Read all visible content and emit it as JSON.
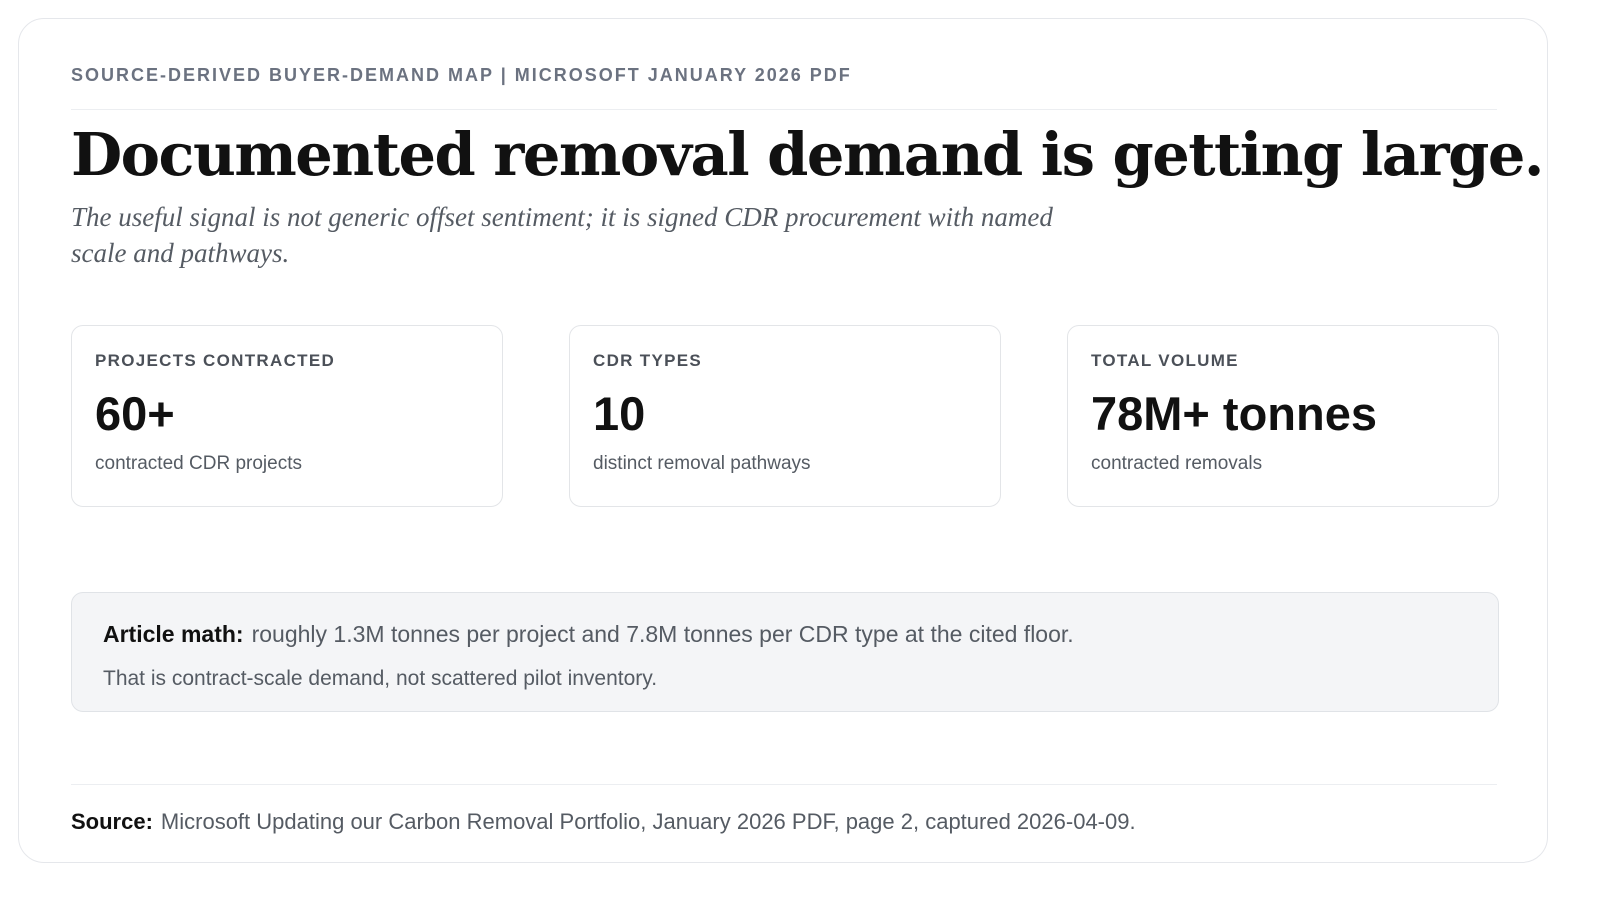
{
  "eyebrow": "SOURCE-DERIVED BUYER-DEMAND MAP | MICROSOFT JANUARY 2026 PDF",
  "headline": "Documented removal demand is getting large.",
  "subhead": "The useful signal is not generic offset sentiment; it is signed CDR procurement with named scale and pathways.",
  "stats": [
    {
      "label": "PROJECTS CONTRACTED",
      "value": "60+",
      "note": "contracted CDR projects"
    },
    {
      "label": "CDR TYPES",
      "value": "10",
      "note": "distinct removal pathways"
    },
    {
      "label": "TOTAL VOLUME",
      "value": "78M+ tonnes",
      "note": "contracted removals"
    }
  ],
  "callout": {
    "key": "Article math:",
    "text": "roughly 1.3M tonnes per project and 7.8M tonnes per CDR type at the cited floor.",
    "followup": "That is contract-scale demand, not scattered pilot inventory."
  },
  "source": {
    "key": "Source:",
    "text": "Microsoft Updating our Carbon Removal Portfolio, January 2026 PDF, page 2, captured 2026-04-09."
  }
}
